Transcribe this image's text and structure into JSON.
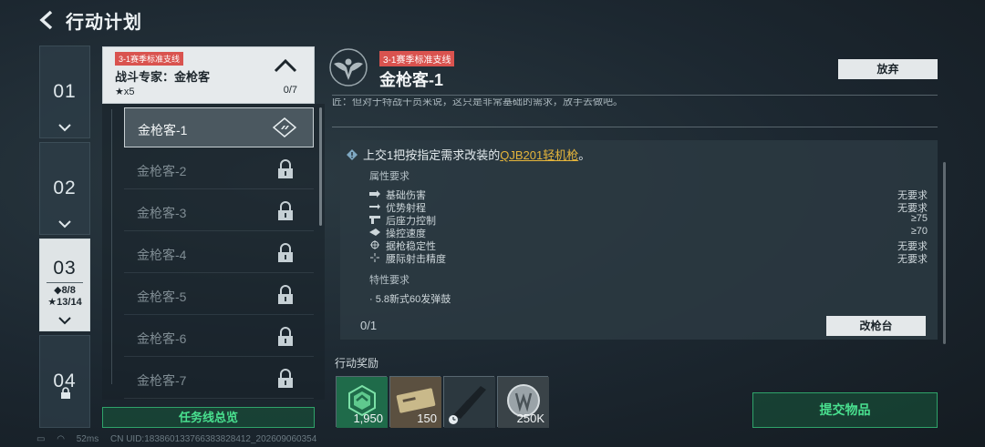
{
  "header": {
    "title": "行动计划"
  },
  "chapters": [
    {
      "num": "01"
    },
    {
      "num": "02"
    },
    {
      "num": "03",
      "stat_diamond": "◆8/8",
      "stat_star": "★13/14"
    },
    {
      "num": "04"
    }
  ],
  "task_group": {
    "tag": "3-1赛季标准支线",
    "name": "战斗专家：金枪客",
    "stars": "★x5",
    "progress": "0/7"
  },
  "tasks": [
    {
      "label": "金枪客-1"
    },
    {
      "label": "金枪客-2"
    },
    {
      "label": "金枪客-3"
    },
    {
      "label": "金枪客-4"
    },
    {
      "label": "金枪客-5"
    },
    {
      "label": "金枪客-6"
    },
    {
      "label": "金枪客-7"
    }
  ],
  "overview_button": "任务线总览",
  "status_bar": {
    "ping": "52ms",
    "uid": "CN UID:18386013376638382841​2_202609060354"
  },
  "detail": {
    "tag": "3-1赛季标准支线",
    "title": "金枪客-1",
    "abandon": "放弃",
    "cut_text": "匠：但对于特战干员来说，这只是非常基础的需求，放手去做吧。",
    "requirement_prefix": "上交1把按指定需求改装的",
    "requirement_item": "QJB201轻机枪",
    "requirement_suffix": "。",
    "attr_title": "属性要求",
    "attributes": [
      {
        "name": "基础伤害",
        "value": "无要求"
      },
      {
        "name": "优势射程",
        "value": "无要求"
      },
      {
        "name": "后座力控制",
        "value": "≥75"
      },
      {
        "name": "操控速度",
        "value": "≥70"
      },
      {
        "name": "据枪稳定性",
        "value": "无要求"
      },
      {
        "name": "腰际射击精度",
        "value": "无要求"
      }
    ],
    "trait_title": "特性要求",
    "trait_item": "· 5.8新式60发弹鼓",
    "count": "0/1",
    "mod_button": "改枪台"
  },
  "rewards": {
    "title": "行动奖励",
    "items": [
      {
        "qty": "1,950"
      },
      {
        "qty": "150"
      },
      {
        "qty": ""
      },
      {
        "qty": "250K"
      }
    ]
  },
  "submit_button": "提交物品",
  "colors": {
    "accent_green": "#49e08f",
    "tag_red": "#d9534f",
    "highlight_gold": "#e5b53b"
  }
}
